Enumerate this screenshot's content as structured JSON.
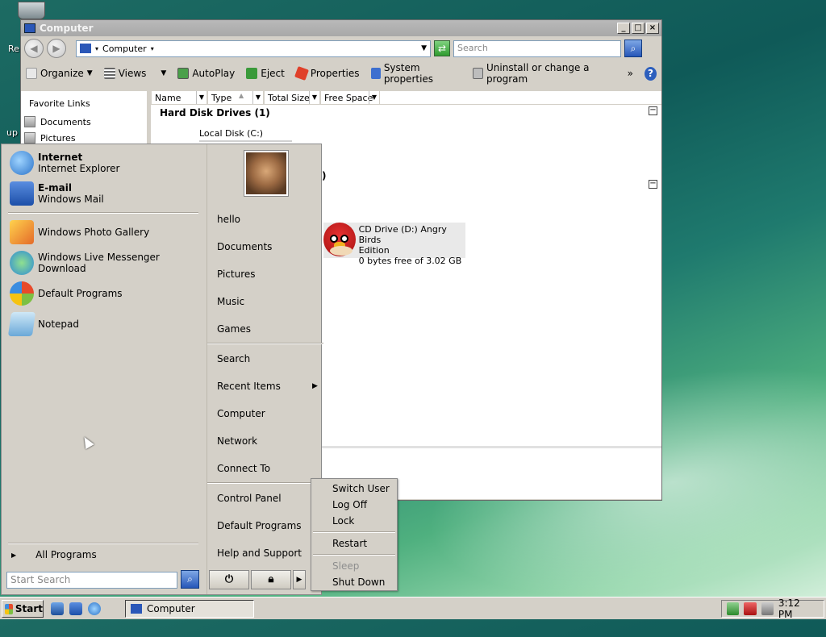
{
  "desktop": {
    "recycle_bin_label": "Re",
    "partial_label": "up"
  },
  "window": {
    "title": "Computer",
    "address": "Computer",
    "search_placeholder": "Search"
  },
  "toolbar": {
    "organize": "Organize",
    "views": "Views",
    "autoplay": "AutoPlay",
    "eject": "Eject",
    "properties": "Properties",
    "system_properties": "System properties",
    "uninstall": "Uninstall or change a program",
    "more": "»"
  },
  "favorites": {
    "title": "Favorite Links",
    "items": [
      "Documents",
      "Pictures"
    ]
  },
  "columns": [
    "Name",
    "Type",
    "Total Size",
    "Free Space"
  ],
  "groups": {
    "hard_disk": "Hard Disk Drives (1)",
    "removable_suffix": ")"
  },
  "drives": {
    "local_disk": "Local Disk (C:)",
    "cd_line1": "CD Drive (D:) Angry Birds",
    "cd_line2": "Edition",
    "cd_free": "0 bytes free of 3.02 GB"
  },
  "start_menu": {
    "pinned": [
      {
        "title": "Internet",
        "subtitle": "Internet Explorer"
      },
      {
        "title": "E-mail",
        "subtitle": "Windows Mail"
      }
    ],
    "programs": [
      "Windows Photo Gallery",
      "Windows Live Messenger Download",
      "Default Programs",
      "Notepad"
    ],
    "all_programs": "All Programs",
    "search_placeholder": "Start Search",
    "right": {
      "user": "hello",
      "documents": "Documents",
      "pictures": "Pictures",
      "music": "Music",
      "games": "Games",
      "search": "Search",
      "recent": "Recent Items",
      "computer": "Computer",
      "network": "Network",
      "connect": "Connect To",
      "control_panel": "Control Panel",
      "default_programs": "Default Programs",
      "help": "Help and Support"
    }
  },
  "power_menu": {
    "switch_user": "Switch User",
    "log_off": "Log Off",
    "lock": "Lock",
    "restart": "Restart",
    "sleep": "Sleep",
    "shut_down": "Shut Down"
  },
  "taskbar": {
    "start": "Start",
    "task": "Computer",
    "clock": "3:12 PM"
  }
}
